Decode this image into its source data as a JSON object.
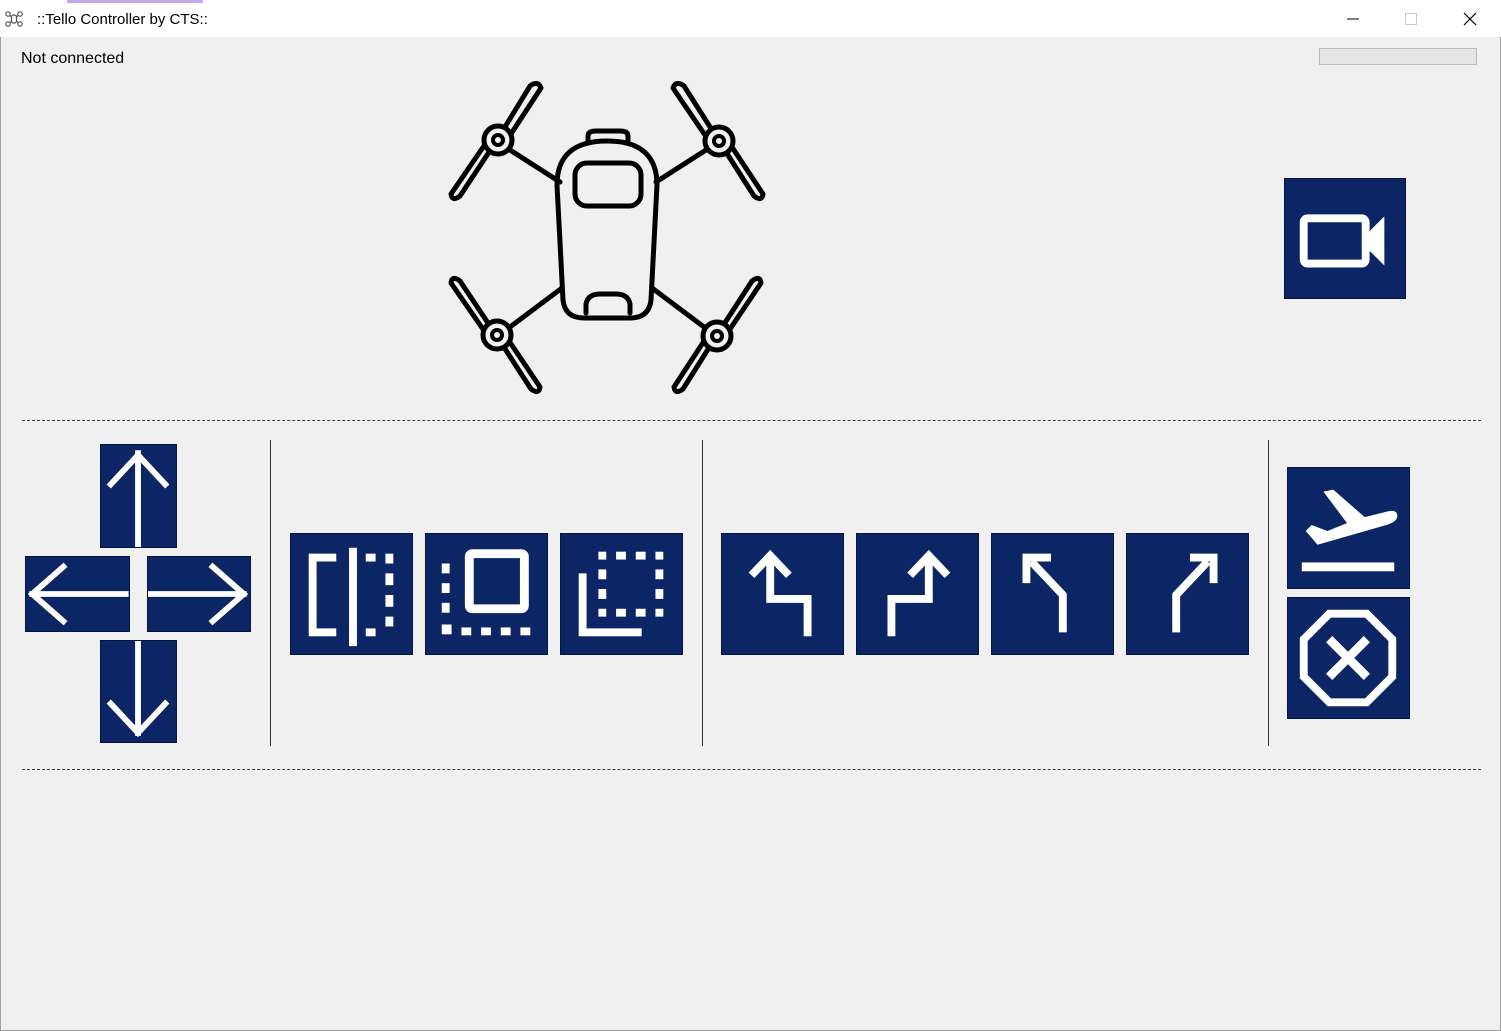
{
  "window": {
    "title": "::Tello Controller by CTS::",
    "controls": [
      "minimize-icon",
      "maximize-icon",
      "close-icon"
    ]
  },
  "status": {
    "connection_text": "Not connected",
    "battery_progress_percent": 0
  },
  "theme": {
    "button_color": "#0c2565",
    "icon_color": "#ffffff",
    "background": "#f0f0f0"
  },
  "controls": {
    "camera": {
      "icon": "video-camera-icon"
    },
    "direction_pad": [
      "arrow-up-icon",
      "arrow-left-icon",
      "arrow-right-icon",
      "arrow-down-icon"
    ],
    "flip_group": [
      "flip-mirror-icon",
      "frame-center-icon",
      "frame-corner-icon"
    ],
    "turn_group": [
      "turn-left-icon",
      "turn-right-icon",
      "bear-left-icon",
      "bear-right-icon"
    ],
    "flight": [
      "takeoff-icon",
      "emergency-stop-icon"
    ]
  }
}
